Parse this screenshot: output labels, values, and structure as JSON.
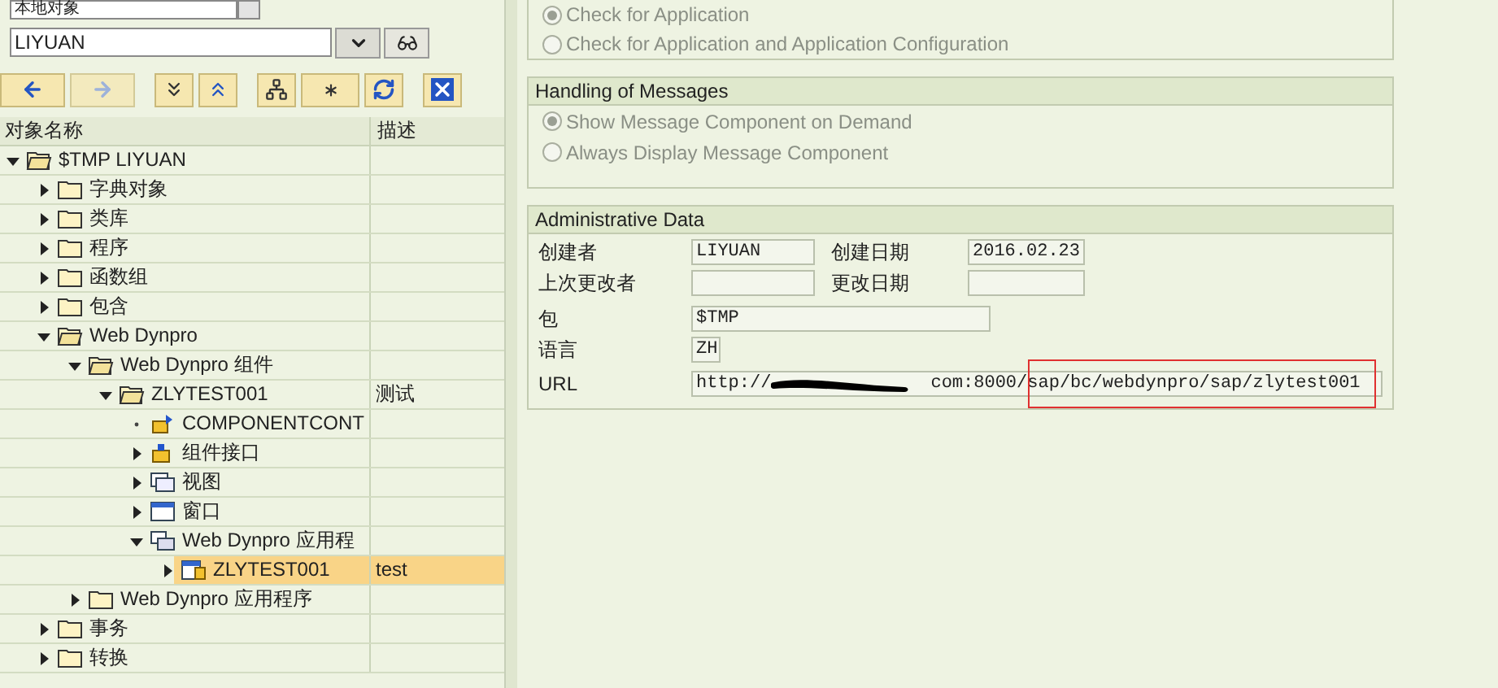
{
  "object_type_dropdown": {
    "value": "本地对象"
  },
  "object_field": {
    "value": "LIYUAN"
  },
  "tree": {
    "columns": [
      "对象名称",
      "描述"
    ],
    "nodes": [
      {
        "label": "$TMP LIYUAN",
        "kind": "folder",
        "expanded": true,
        "selected": false,
        "children": [
          {
            "label": "字典对象",
            "kind": "folder",
            "expanded": false,
            "selected": false
          },
          {
            "label": "类库",
            "kind": "folder",
            "expanded": false,
            "selected": false
          },
          {
            "label": "程序",
            "kind": "folder",
            "expanded": false,
            "selected": false
          },
          {
            "label": "函数组",
            "kind": "folder",
            "expanded": false,
            "selected": false
          },
          {
            "label": "包含",
            "kind": "folder",
            "expanded": false,
            "selected": false
          },
          {
            "label": "Web Dynpro",
            "kind": "folder",
            "expanded": true,
            "selected": false,
            "children": [
              {
                "label": "Web Dynpro 组件",
                "kind": "folder",
                "expanded": true,
                "selected": false,
                "children": [
                  {
                    "label": "ZLYTEST001",
                    "description": "测试",
                    "kind": "folder",
                    "expanded": true,
                    "selected": false,
                    "children": [
                      {
                        "label": "COMPONENTCONT",
                        "kind": "controller",
                        "selected": false
                      },
                      {
                        "label": "组件接口",
                        "kind": "interface",
                        "expanded": false,
                        "selected": false
                      },
                      {
                        "label": "视图",
                        "kind": "view",
                        "expanded": false,
                        "selected": false
                      },
                      {
                        "label": "窗口",
                        "kind": "window",
                        "expanded": false,
                        "selected": false
                      },
                      {
                        "label": "Web Dynpro 应用程",
                        "kind": "app",
                        "expanded": true,
                        "selected": false,
                        "children": [
                          {
                            "label": "ZLYTEST001",
                            "description": "test",
                            "kind": "app-item",
                            "expanded": false,
                            "selected": true
                          }
                        ]
                      }
                    ]
                  }
                ]
              },
              {
                "label": "Web Dynpro 应用程序",
                "kind": "folder",
                "expanded": false,
                "selected": false
              }
            ]
          },
          {
            "label": "事务",
            "kind": "folder",
            "expanded": false,
            "selected": false
          },
          {
            "label": "转换",
            "kind": "folder",
            "expanded": false,
            "selected": false
          }
        ]
      }
    ]
  },
  "check_group": {
    "options": [
      {
        "label": "Check for Application",
        "selected": true
      },
      {
        "label": "Check for Application and Application Configuration",
        "selected": false
      }
    ]
  },
  "messages_group": {
    "title": "Handling of Messages",
    "options": [
      {
        "label": "Show Message Component on Demand",
        "selected": true
      },
      {
        "label": "Always Display Message Component",
        "selected": false
      }
    ]
  },
  "admin_group": {
    "title": "Administrative Data",
    "created_by": {
      "label": "创建者",
      "value": "LIYUAN"
    },
    "created_on": {
      "label": "创建日期",
      "value": "2016.02.23"
    },
    "changed_by": {
      "label": "上次更改者"
    },
    "changed_on": {
      "label": "更改日期"
    },
    "package": {
      "label": "包",
      "value": "$TMP"
    },
    "language": {
      "label": "语言",
      "value": "ZH"
    },
    "url": {
      "label": "URL",
      "prefix": "http://",
      "suffix": "com:8000/",
      "highlighted": "sap/bc/webdynpro/sap/zlytest001"
    }
  }
}
